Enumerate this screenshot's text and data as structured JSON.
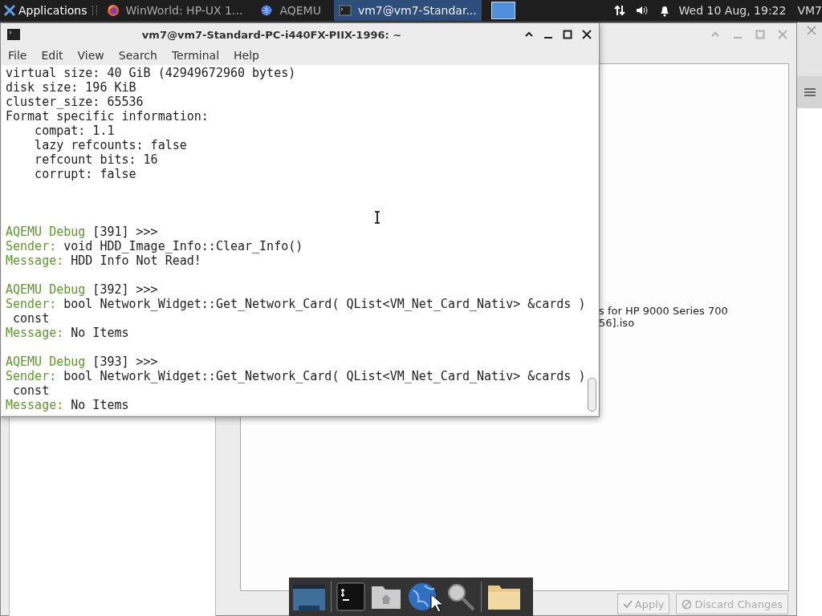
{
  "panel": {
    "menu": "Applications",
    "tasks": [
      {
        "title": "WinWorld: HP-UX 1...",
        "selected": false
      },
      {
        "title": "AQEMU",
        "selected": false
      },
      {
        "title": "vm7@vm7-Standar...",
        "selected": true
      }
    ],
    "clock": "Wed 10 Aug, 19:22",
    "user": "VM7"
  },
  "terminal": {
    "title": "vm7@vm7-Standard-PC-i440FX-PIIX-1996: ~",
    "menu": [
      "File",
      "Edit",
      "View",
      "Search",
      "Terminal",
      "Help"
    ],
    "lines": [
      {
        "kind": "plain",
        "text": "virtual size: 40 GiB (42949672960 bytes)"
      },
      {
        "kind": "plain",
        "text": "disk size: 196 KiB"
      },
      {
        "kind": "plain",
        "text": "cluster_size: 65536"
      },
      {
        "kind": "plain",
        "text": "Format specific information:"
      },
      {
        "kind": "plain",
        "text": "    compat: 1.1"
      },
      {
        "kind": "plain",
        "text": "    lazy refcounts: false"
      },
      {
        "kind": "plain",
        "text": "    refcount bits: 16"
      },
      {
        "kind": "plain",
        "text": "    corrupt: false"
      },
      {
        "kind": "blank"
      },
      {
        "kind": "blank"
      },
      {
        "kind": "blank"
      },
      {
        "kind": "tagged",
        "tag": "AQEMU Debug",
        "text": " [391] >>>"
      },
      {
        "kind": "tagged",
        "tag": "Sender:",
        "text": " void HDD_Image_Info::Clear_Info()"
      },
      {
        "kind": "tagged",
        "tag": "Message:",
        "text": " HDD Info Not Read!"
      },
      {
        "kind": "blank"
      },
      {
        "kind": "tagged",
        "tag": "AQEMU Debug",
        "text": " [392] >>>"
      },
      {
        "kind": "tagged",
        "tag": "Sender:",
        "text": " bool Network_Widget::Get_Network_Card( QList<VM_Net_Card_Nativ> &cards )"
      },
      {
        "kind": "plain",
        "text": " const"
      },
      {
        "kind": "tagged",
        "tag": "Message:",
        "text": " No Items"
      },
      {
        "kind": "blank"
      },
      {
        "kind": "tagged",
        "tag": "AQEMU Debug",
        "text": " [393] >>>"
      },
      {
        "kind": "tagged",
        "tag": "Sender:",
        "text": " bool Network_Widget::Get_Network_Card( QList<VM_Net_Card_Nativ> &cards )"
      },
      {
        "kind": "plain",
        "text": " const"
      },
      {
        "kind": "tagged",
        "tag": "Message:",
        "text": " No Items"
      }
    ]
  },
  "aqemu": {
    "details": [
      "s for HP 9000 Series 700",
      "56].iso"
    ],
    "buttons": [
      {
        "label": "Apply",
        "disabled": true
      },
      {
        "label": "Discard Changes",
        "disabled": true
      }
    ]
  }
}
